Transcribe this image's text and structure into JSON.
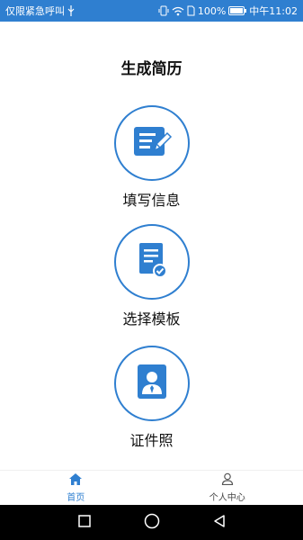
{
  "status_bar": {
    "carrier_text": "仅限紧急呼叫",
    "battery_percent": "100%",
    "time": "中午11:02",
    "icons": [
      "usb-icon",
      "vibrate-icon",
      "wifi-icon",
      "sim-icon",
      "battery-icon"
    ]
  },
  "page": {
    "title": "生成简历"
  },
  "menu": [
    {
      "label": "填写信息",
      "icon": "edit-document-icon"
    },
    {
      "label": "选择模板",
      "icon": "document-check-icon"
    },
    {
      "label": "证件照",
      "icon": "id-photo-icon"
    }
  ],
  "bottom_nav": [
    {
      "label": "首页",
      "icon": "home-icon",
      "active": true
    },
    {
      "label": "个人中心",
      "icon": "user-icon",
      "active": false
    }
  ],
  "system_nav": [
    "recent-apps-button",
    "home-button",
    "back-button"
  ],
  "colors": {
    "accent": "#2f7fd0",
    "status_bar": "#2f7fd0",
    "system_nav": "#000000"
  }
}
